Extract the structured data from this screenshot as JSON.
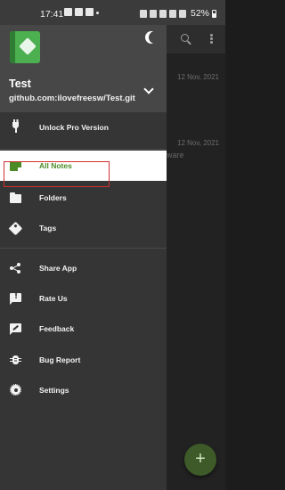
{
  "status_bar": {
    "time": "17:41",
    "battery": "52%"
  },
  "background": {
    "dates": [
      "12 Nov, 2021",
      "12 Nov, 2021"
    ],
    "snippet": "ware",
    "fab_label": "+"
  },
  "drawer": {
    "repo_name": "Test",
    "repo_url": "github.com:ilovefreesw/Test.git",
    "items": [
      {
        "label": "Unlock Pro Version",
        "icon": "plug-icon"
      },
      {
        "label": "All Notes",
        "icon": "note-icon",
        "active": true
      },
      {
        "label": "Folders",
        "icon": "folder-icon",
        "highlighted": true
      },
      {
        "label": "Tags",
        "icon": "tag-icon"
      },
      {
        "label": "Share App",
        "icon": "share-icon"
      },
      {
        "label": "Rate Us",
        "icon": "rate-icon"
      },
      {
        "label": "Feedback",
        "icon": "feedback-icon"
      },
      {
        "label": "Bug Report",
        "icon": "bug-icon"
      },
      {
        "label": "Settings",
        "icon": "gear-icon"
      }
    ]
  },
  "colors": {
    "accent_green": "#4a8b25",
    "highlight_red": "#d32f2f",
    "drawer_bg": "#353535",
    "header_bg": "#474747"
  }
}
